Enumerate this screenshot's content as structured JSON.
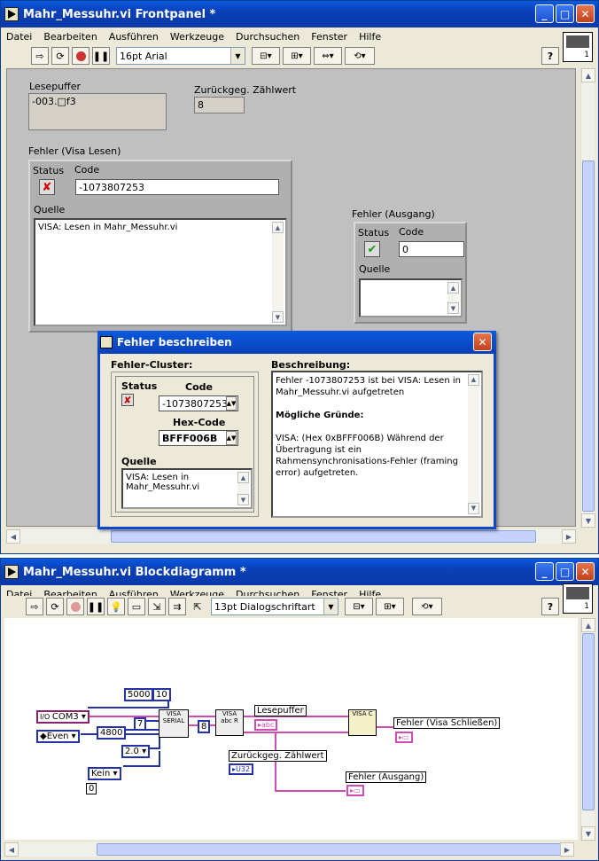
{
  "front_panel": {
    "title": "Mahr_Messuhr.vi Frontpanel *",
    "menu": [
      "Datei",
      "Bearbeiten",
      "Ausführen",
      "Werkzeuge",
      "Durchsuchen",
      "Fenster",
      "Hilfe"
    ],
    "font_selector": "16pt Arial",
    "vi_icon_number": "1",
    "lesepuffer": {
      "label": "Lesepuffer",
      "value": "-003.□f3"
    },
    "zaehlwert": {
      "label": "Zurückgeg. Zählwert",
      "value": "8"
    },
    "fehler_visa_lesen": {
      "label": "Fehler (Visa Lesen)",
      "status_label": "Status",
      "code_label": "Code",
      "code_value": "-1073807253",
      "quelle_label": "Quelle",
      "quelle_value": "VISA: Lesen in Mahr_Messuhr.vi"
    },
    "fehler_ausgang": {
      "label": "Fehler (Ausgang)",
      "status_label": "Status",
      "code_label": "Code",
      "code_value": "0",
      "quelle_label": "Quelle"
    }
  },
  "dialog": {
    "title": "Fehler beschreiben",
    "cluster_label": "Fehler-Cluster:",
    "status_label": "Status",
    "code_label": "Code",
    "code_value": "-1073807253",
    "hex_label": "Hex-Code",
    "hex_value": "BFFF006B",
    "quelle_label": "Quelle",
    "quelle_value": "VISA: Lesen in Mahr_Messuhr.vi",
    "beschreibung_label": "Beschreibung:",
    "beschreibung_line1": "Fehler -1073807253 ist bei VISA: Lesen in Mahr_Messuhr.vi aufgetreten",
    "moegliche_gruende": "Mögliche Gründe:",
    "beschreibung_detail": "VISA:  (Hex 0xBFFF006B) Während der Übertragung ist ein Rahmensynchronisations-Fehler (framing error) aufgetreten."
  },
  "block_diagram": {
    "title": "Mahr_Messuhr.vi Blockdiagramm *",
    "menu": [
      "Datei",
      "Bearbeiten",
      "Ausführen",
      "Werkzeuge",
      "Durchsuchen",
      "Fenster",
      "Hilfe"
    ],
    "font_selector": "13pt Dialogschriftart",
    "vi_icon_number": "1",
    "constants": {
      "timeout": "5000",
      "term_char": "10",
      "resource": "COM3",
      "parity": "Even",
      "baud": "4800",
      "data_bits": "7",
      "stop_bits": "2.0",
      "flow": "Kein",
      "flow_val": "0",
      "bytes": "8"
    },
    "labels": {
      "lesepuffer": "Lesepuffer",
      "zaehlwert": "Zurückgeg. Zählwert",
      "fehler_schliessen": "Fehler (Visa Schließen)",
      "fehler_ausgang": "Fehler (Ausgang)"
    },
    "nodes": {
      "serial": "VISA SERIAL",
      "read": "VISA abc R",
      "close": "VISA C"
    },
    "terminals": {
      "abc": "abc",
      "u32": "U32"
    }
  }
}
